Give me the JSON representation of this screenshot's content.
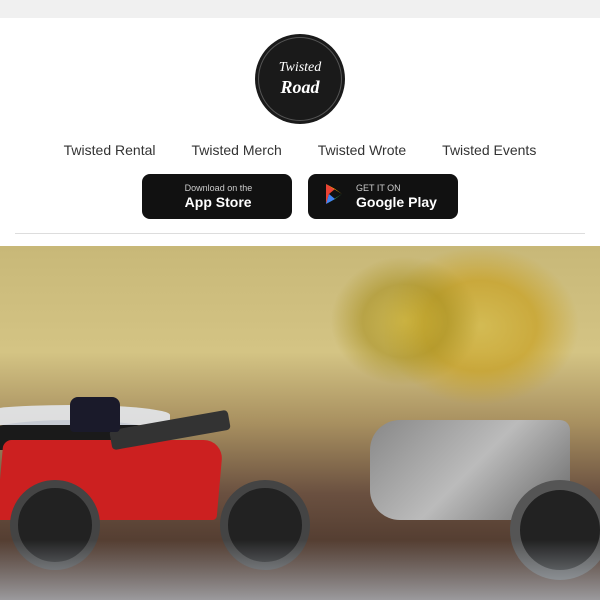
{
  "topbar": {},
  "header": {
    "logo": {
      "line1": "Twisted",
      "line2": "Road"
    },
    "nav": {
      "items": [
        {
          "label": "Twisted Rental",
          "id": "twisted-rental"
        },
        {
          "label": "Twisted Merch",
          "id": "twisted-merch"
        },
        {
          "label": "Twisted Wrote",
          "id": "twisted-wrote"
        },
        {
          "label": "Twisted Events",
          "id": "twisted-events"
        }
      ]
    },
    "appButtons": {
      "appStore": {
        "smallText": "Download on the",
        "bigText": "App Store"
      },
      "googlePlay": {
        "smallText": "GET IT ON",
        "bigText": "Google Play"
      }
    }
  },
  "hero": {
    "altText": "Motorcycles in snow"
  }
}
